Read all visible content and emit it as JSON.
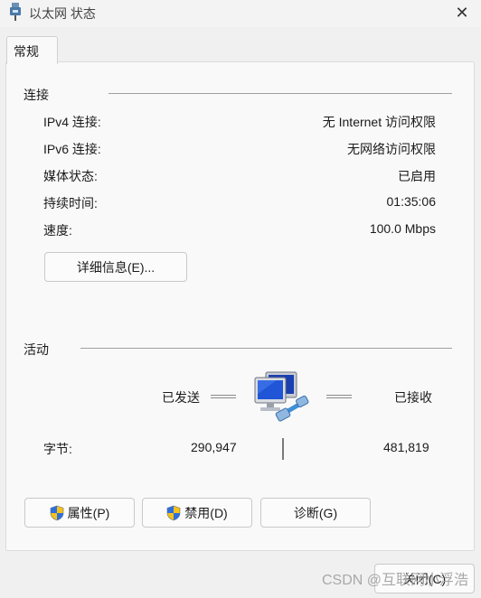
{
  "window": {
    "title": "以太网 状态"
  },
  "tabs": [
    {
      "label": "常规"
    }
  ],
  "connection": {
    "header": "连接",
    "rows": [
      {
        "label": "IPv4 连接:",
        "value": "无 Internet 访问权限"
      },
      {
        "label": "IPv6 连接:",
        "value": "无网络访问权限"
      },
      {
        "label": "媒体状态:",
        "value": "已启用"
      },
      {
        "label": "持续时间:",
        "value": "01:35:06"
      },
      {
        "label": "速度:",
        "value": "100.0 Mbps"
      }
    ],
    "details_button": "详细信息(E)..."
  },
  "activity": {
    "header": "活动",
    "sent_label": "已发送",
    "received_label": "已接收",
    "bytes_label": "字节:",
    "bytes_sent": "290,947",
    "bytes_received": "481,819"
  },
  "buttons": {
    "properties": "属性(P)",
    "disable": "禁用(D)",
    "diagnose": "诊断(G)",
    "close": "关闭(C)"
  },
  "watermark": "CSDN @互联网小浮浩",
  "icons": {
    "window": "network-adapter-icon",
    "close": "close-icon",
    "activity": "network-computers-icon",
    "shield": "uac-shield-icon"
  }
}
